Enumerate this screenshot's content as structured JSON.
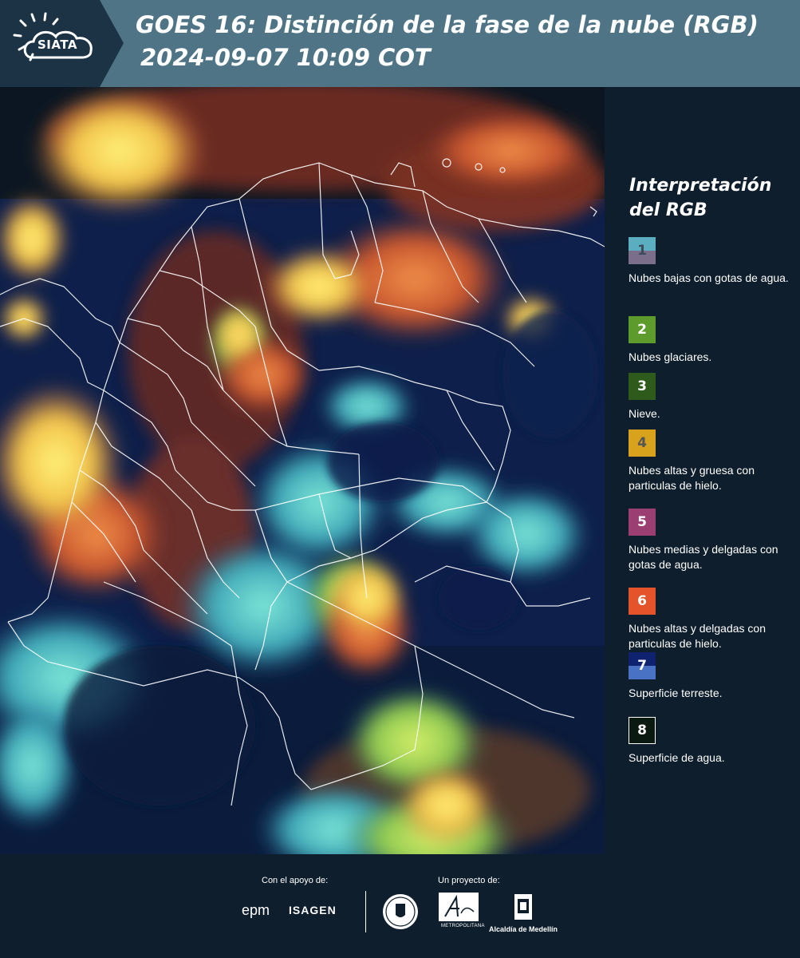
{
  "header": {
    "logo_text": "SIATA",
    "title_line1": "GOES 16: Distinción de la fase de la nube (RGB)",
    "title_line2": "2024-09-07 10:09 COT"
  },
  "legend": {
    "title": "Interpretación del RGB",
    "items": [
      {
        "number": "1",
        "label": "Nubes bajas con gotas de agua.",
        "color_top": "#5aaec0",
        "color_bottom": "#7a6e8a",
        "number_color": "#3d4a5a"
      },
      {
        "number": "2",
        "label": "Nubes glaciares.",
        "color_top": "#5d9b2c",
        "color_bottom": "#5d9b2c",
        "number_color": "#ffffff"
      },
      {
        "number": "3",
        "label": "Nieve.",
        "color_top": "#2e5a1c",
        "color_bottom": "#2e5a1c",
        "number_color": "#ffffff"
      },
      {
        "number": "4",
        "label": "Nubes altas y gruesa con particulas de hielo.",
        "color_top": "#d9a21c",
        "color_bottom": "#d9a21c",
        "number_color": "#555555"
      },
      {
        "number": "5",
        "label": "Nubes medias y delgadas con gotas de agua.",
        "color_top": "#9b3f73",
        "color_bottom": "#9b3f73",
        "number_color": "#ffffff"
      },
      {
        "number": "6",
        "label": "Nubes altas y delgadas con particulas de hielo.",
        "color_top": "#e4532a",
        "color_bottom": "#e4532a",
        "number_color": "#ffffff"
      },
      {
        "number": "7",
        "label": "Superficie terreste.",
        "color_top": "#0f2270",
        "color_bottom": "#4a72c4",
        "number_color": "#ffffff"
      },
      {
        "number": "8",
        "label": "Superficie de agua.",
        "color_top": "#0b1a10",
        "color_bottom": "#0b1a10",
        "number_color": "#ffffff"
      }
    ]
  },
  "footer": {
    "support_label": "Con el apoyo de:",
    "project_label": "Un proyecto de:",
    "epm": "epm",
    "isagen": "ISAGEN",
    "metro_text": "METROPOLITANA",
    "alcaldia": "Alcaldía de Medellín"
  }
}
